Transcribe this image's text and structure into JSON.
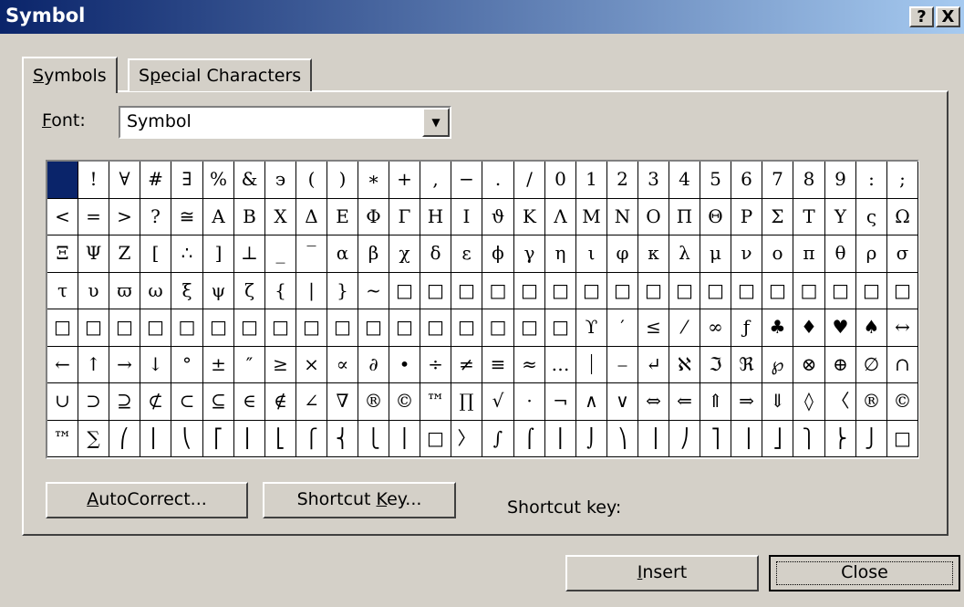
{
  "title": "Symbol",
  "title_buttons": [
    "?",
    "X"
  ],
  "tabs": [
    {
      "label_pre": "",
      "label_mnemonic": "S",
      "label_post": "ymbols"
    },
    {
      "label_pre": "S",
      "label_mnemonic": "p",
      "label_post": "ecial Characters"
    }
  ],
  "font": {
    "label_mnemonic": "F",
    "label_post": "ont:",
    "value": "Symbol"
  },
  "grid_rows": [
    [
      " ",
      "!",
      "∀",
      "#",
      "∃",
      "%",
      "&",
      "϶",
      "(",
      ")",
      "∗",
      "+",
      ",",
      "−",
      ".",
      "/",
      "0",
      "1",
      "2",
      "3",
      "4",
      "5",
      "6",
      "7",
      "8",
      "9",
      ":",
      ";"
    ],
    [
      "<",
      "=",
      ">",
      "?",
      "≅",
      "Α",
      "Β",
      "Χ",
      "Δ",
      "Ε",
      "Φ",
      "Γ",
      "Η",
      "Ι",
      "ϑ",
      "Κ",
      "Λ",
      "Μ",
      "Ν",
      "Ο",
      "Π",
      "Θ",
      "Ρ",
      "Σ",
      "Τ",
      "Υ",
      "ς",
      "Ω"
    ],
    [
      "Ξ",
      "Ψ",
      "Ζ",
      "[",
      "∴",
      "]",
      "⊥",
      "_",
      "‾",
      "α",
      "β",
      "χ",
      "δ",
      "ε",
      "ϕ",
      "γ",
      "η",
      "ι",
      "φ",
      "κ",
      "λ",
      "μ",
      "ν",
      "ο",
      "π",
      "θ",
      "ρ",
      "σ"
    ],
    [
      "τ",
      "υ",
      "ϖ",
      "ω",
      "ξ",
      "ψ",
      "ζ",
      "{",
      "|",
      "}",
      "~",
      "□",
      "□",
      "□",
      "□",
      "□",
      "□",
      "□",
      "□",
      "□",
      "□",
      "□",
      "□",
      "□",
      "□",
      "□",
      "□",
      "□"
    ],
    [
      "□",
      "□",
      "□",
      "□",
      "□",
      "□",
      "□",
      "□",
      "□",
      "□",
      "□",
      "□",
      "□",
      "□",
      "□",
      "□",
      "□",
      "ϒ",
      "′",
      "≤",
      "⁄",
      "∞",
      "ƒ",
      "♣",
      "♦",
      "♥",
      "♠",
      "↔"
    ],
    [
      "←",
      "↑",
      "→",
      "↓",
      "°",
      "±",
      "″",
      "≥",
      "×",
      "∝",
      "∂",
      "•",
      "÷",
      "≠",
      "≡",
      "≈",
      "…",
      "⏐",
      "⎯",
      "↵",
      "ℵ",
      "ℑ",
      "ℜ",
      "℘",
      "⊗",
      "⊕",
      "∅",
      "∩"
    ],
    [
      "∪",
      "⊃",
      "⊇",
      "⊄",
      "⊂",
      "⊆",
      "∈",
      "∉",
      "∠",
      "∇",
      "®",
      "©",
      "™",
      "∏",
      "√",
      "⋅",
      "¬",
      "∧",
      "∨",
      "⇔",
      "⇐",
      "⇑",
      "⇒",
      "⇓",
      "◊",
      "〈",
      "®",
      "©"
    ],
    [
      "™",
      "∑",
      "⎛",
      "⎜",
      "⎝",
      "⎡",
      "⎢",
      "⎣",
      "⎧",
      "⎨",
      "⎩",
      "⎪",
      "□",
      "〉",
      "∫",
      "⌠",
      "⎮",
      "⌡",
      "⎞",
      "⎟",
      "⎠",
      "⎤",
      "⎥",
      "⎦",
      "⎫",
      "⎬",
      "⎭",
      "□"
    ]
  ],
  "buttons": {
    "autocorrect": {
      "pre": "",
      "mnemonic": "A",
      "post": "utoCorrect..."
    },
    "shortcut_key": {
      "pre": "Shortcut ",
      "mnemonic": "K",
      "post": "ey..."
    },
    "shortcut_label": "Shortcut key:",
    "insert": {
      "pre": "",
      "mnemonic": "I",
      "post": "nsert"
    },
    "close": "Close"
  }
}
